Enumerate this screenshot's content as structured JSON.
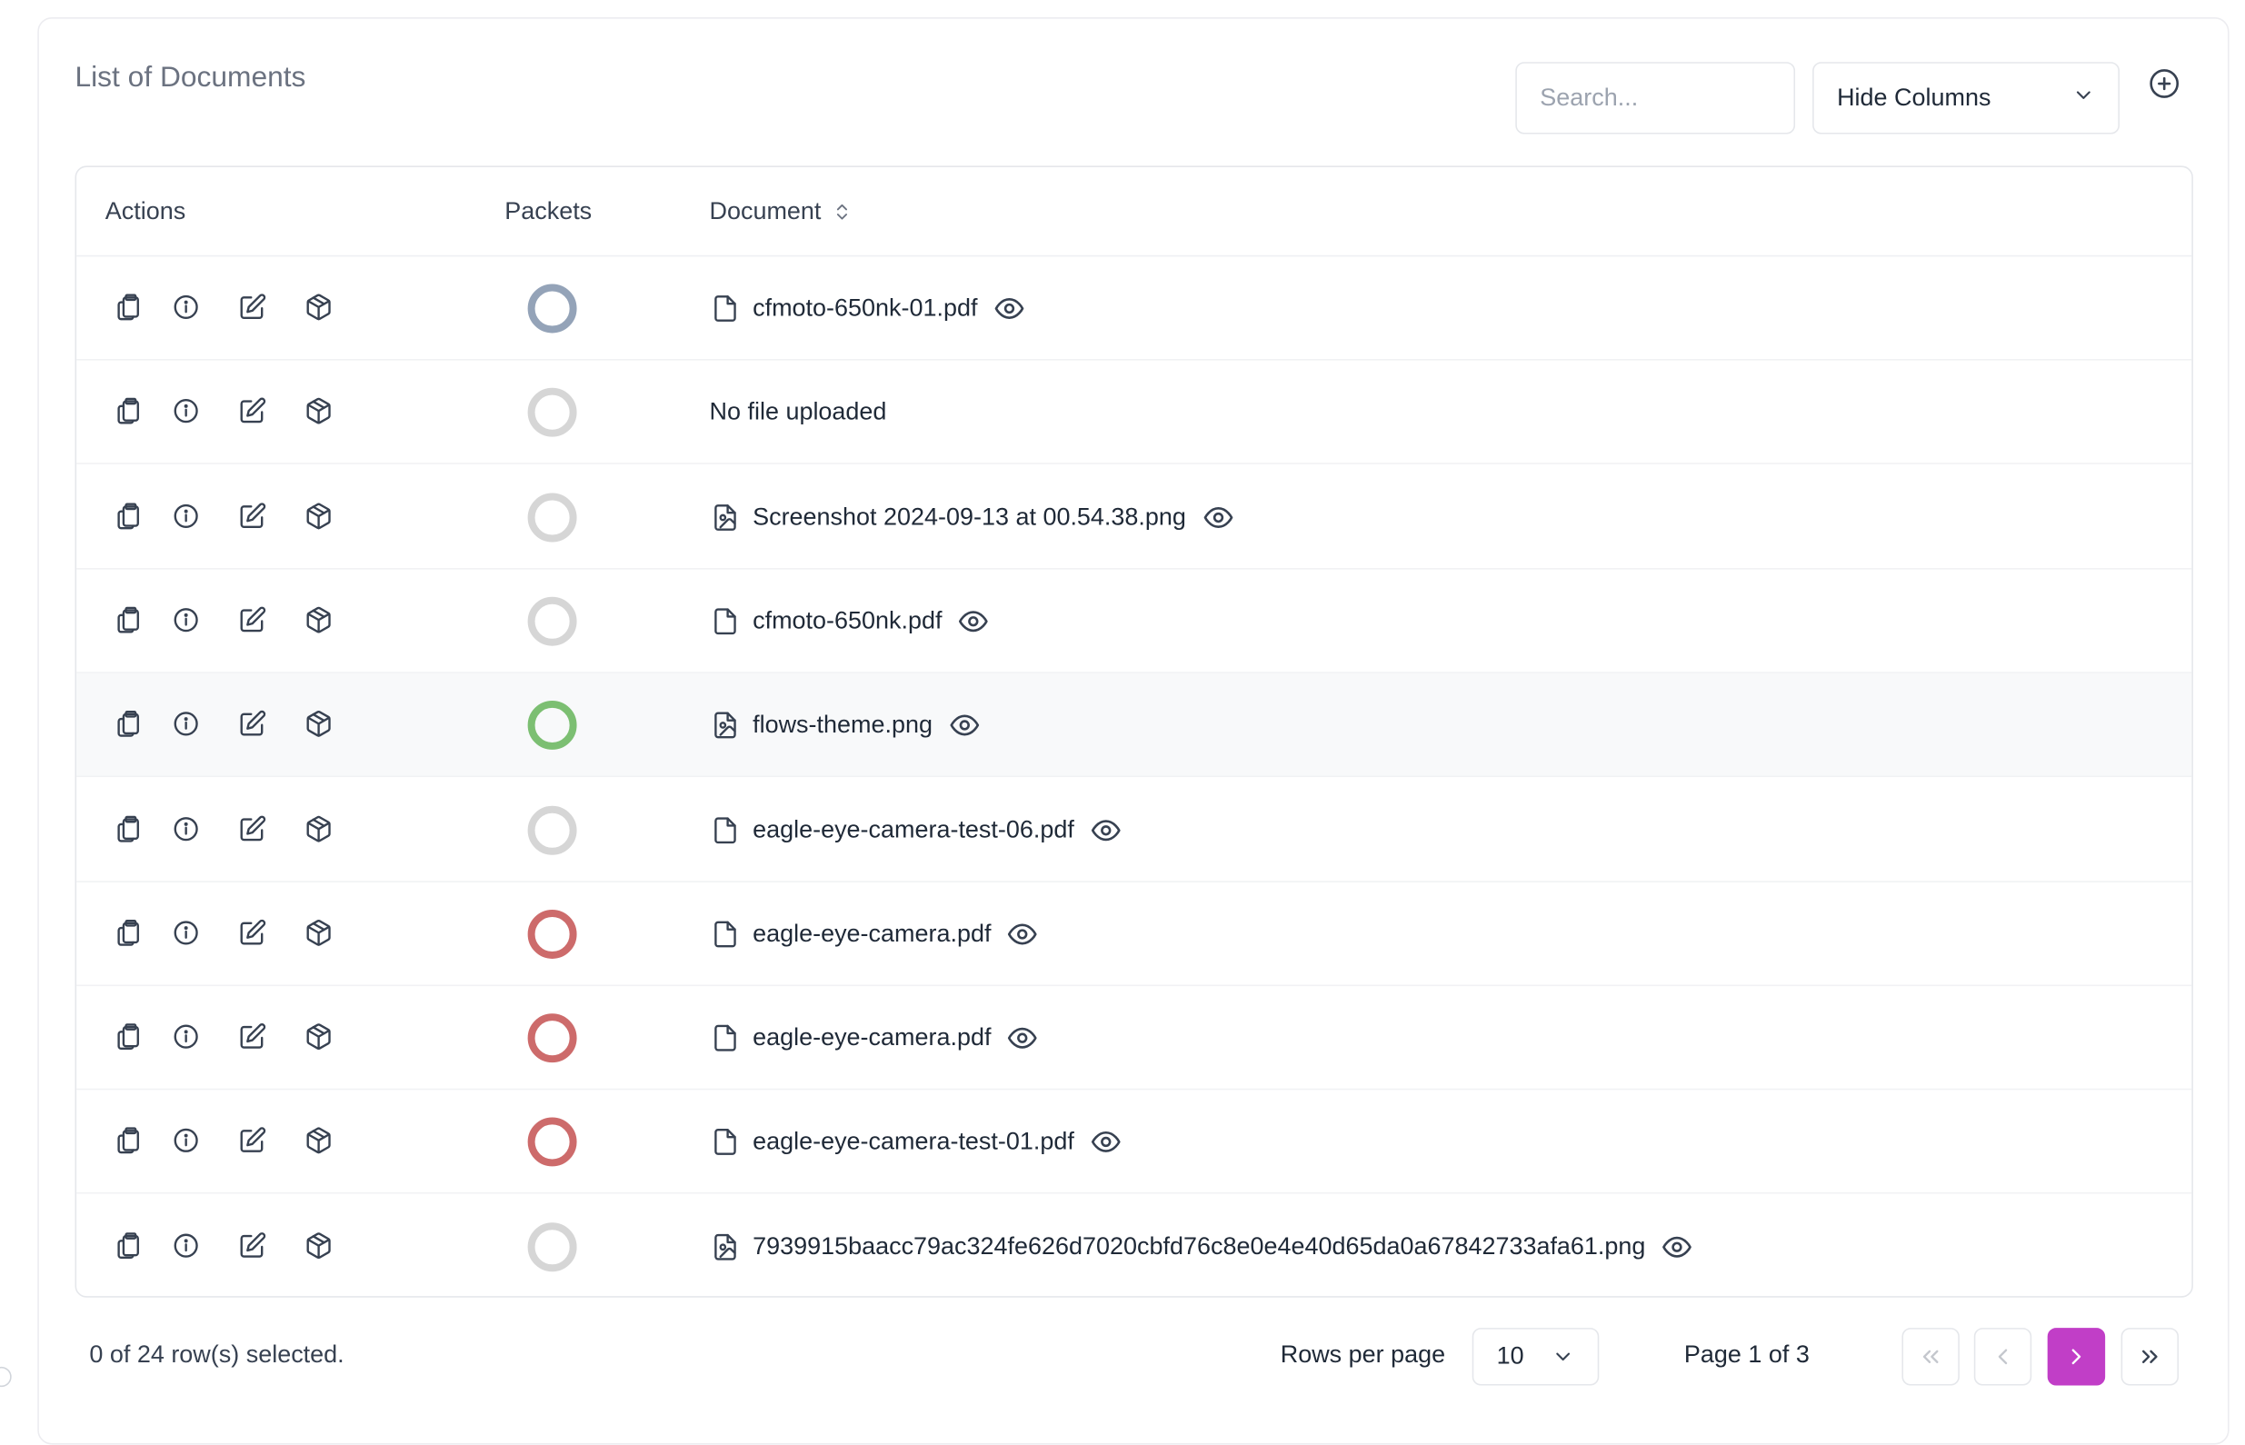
{
  "header": {
    "title": "List of Documents",
    "search_placeholder": "Search...",
    "hide_columns_label": "Hide Columns"
  },
  "table": {
    "columns": [
      "Actions",
      "Packets",
      "Document"
    ],
    "rows": [
      {
        "document": "cfmoto-650nk-01.pdf",
        "file_type": "file-icon",
        "packet_status": "processing",
        "packet_color": "#94a3b8",
        "has_preview": true
      },
      {
        "document": "No file uploaded",
        "file_type": "",
        "packet_status": "empty",
        "packet_color": "#d6d6d6",
        "has_preview": false
      },
      {
        "document": "Screenshot 2024-09-13 at 00.54.38.png",
        "file_type": "image-file-icon",
        "packet_status": "empty",
        "packet_color": "#d6d6d6",
        "has_preview": true
      },
      {
        "document": "cfmoto-650nk.pdf",
        "file_type": "file-icon",
        "packet_status": "empty",
        "packet_color": "#d6d6d6",
        "has_preview": true
      },
      {
        "document": "flows-theme.png",
        "file_type": "image-file-icon",
        "packet_status": "success",
        "packet_color": "#7cbf72",
        "has_preview": true
      },
      {
        "document": "eagle-eye-camera-test-06.pdf",
        "file_type": "file-icon",
        "packet_status": "empty",
        "packet_color": "#d6d6d6",
        "has_preview": true
      },
      {
        "document": "eagle-eye-camera.pdf",
        "file_type": "file-icon",
        "packet_status": "error",
        "packet_color": "#cd6b6b",
        "has_preview": true
      },
      {
        "document": "eagle-eye-camera.pdf",
        "file_type": "file-icon",
        "packet_status": "error",
        "packet_color": "#cd6b6b",
        "has_preview": true
      },
      {
        "document": "eagle-eye-camera-test-01.pdf",
        "file_type": "file-icon",
        "packet_status": "error",
        "packet_color": "#cd6b6b",
        "has_preview": true
      },
      {
        "document": "7939915baacc79ac324fe626d7020cbfd76c8e0e4e40d65da0a67842733afa61.png",
        "file_type": "image-file-icon",
        "packet_status": "empty",
        "packet_color": "#d6d6d6",
        "has_preview": true
      }
    ],
    "highlighted_row": 4
  },
  "footer": {
    "selection_text": "0 of 24 row(s) selected.",
    "rows_per_page_label": "Rows per page",
    "rows_per_page_value": "10",
    "page_info": "Page 1 of 3"
  },
  "colors": {
    "accent": "#c13ec7",
    "border": "#e5e7eb"
  }
}
